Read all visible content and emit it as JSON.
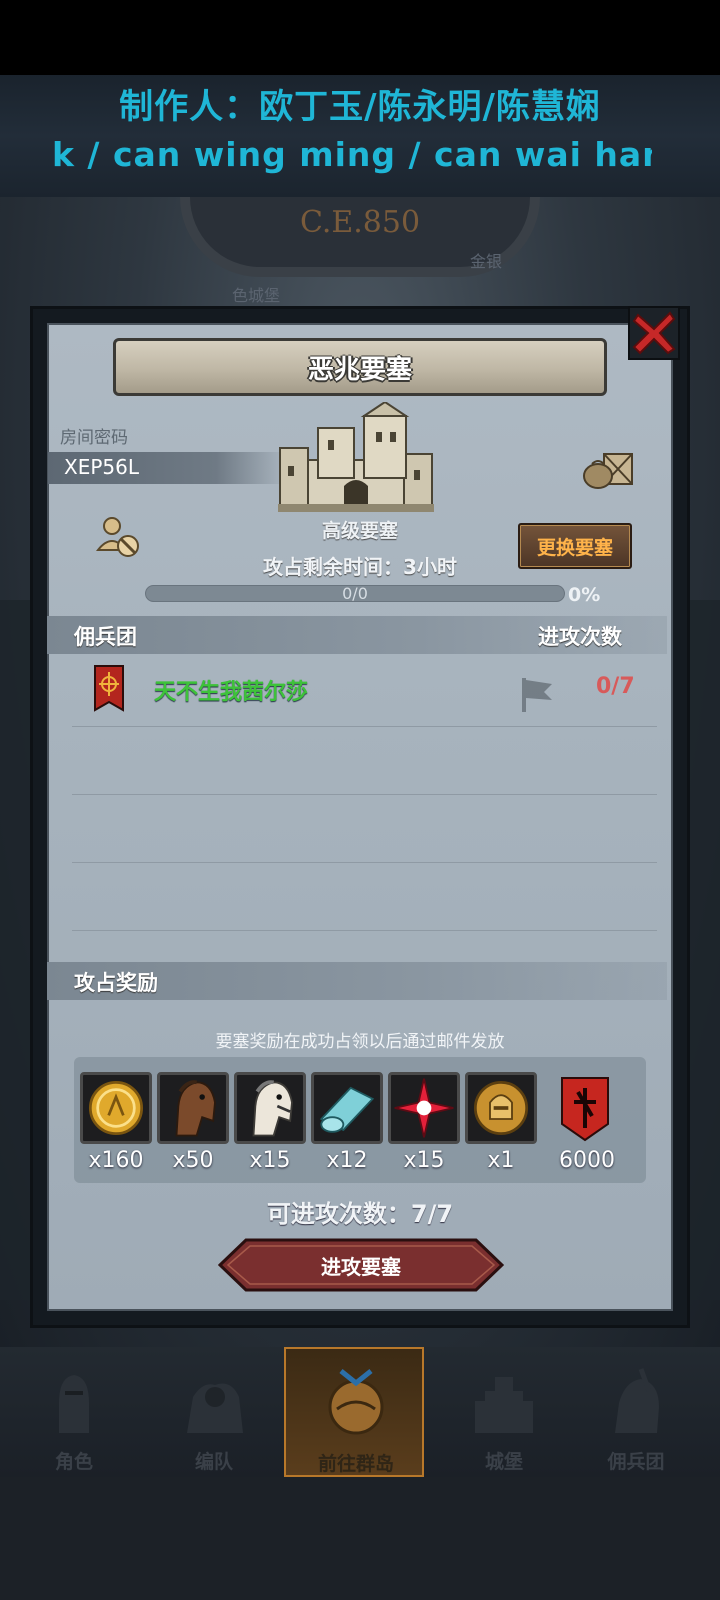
{
  "credits": {
    "line1": "制作人：欧丁玉/陈永明/陈慧娴",
    "line2": "k / can wing ming / can wai han"
  },
  "background": {
    "year": "C.E.850",
    "label_left": "色城堡",
    "label_right": "金银"
  },
  "modal": {
    "title": "恶兆要塞",
    "room_label": "房间密码",
    "room_code": "XEP56L",
    "fort_name": "高级要塞",
    "change_button": "更换要塞",
    "remaining_time": "攻占剩余时间：3小时",
    "progress": {
      "text": "0/0",
      "percent_label": "0%",
      "fraction": 0
    },
    "mercenary_header": "佣兵团",
    "attack_count_header": "进攻次数",
    "mercenaries": [
      {
        "name": "天不生我茜尔莎",
        "count": "0/7"
      }
    ],
    "rewards_header": "攻占奖励",
    "rewards_note": "要塞奖励在成功占领以后通过邮件发放",
    "rewards": [
      {
        "icon": "gold-coin-icon",
        "count": "x160"
      },
      {
        "icon": "brown-horse-icon",
        "count": "x50"
      },
      {
        "icon": "white-horse-icon",
        "count": "x15"
      },
      {
        "icon": "cloth-roll-icon",
        "count": "x12"
      },
      {
        "icon": "red-star-icon",
        "count": "x15"
      },
      {
        "icon": "knight-helmet-coin-icon",
        "count": "x1"
      },
      {
        "icon": "red-banner-icon",
        "count": "6000"
      }
    ],
    "attacks_left": "可进攻次数：7/7",
    "attack_button": "进攻要塞"
  },
  "nav": [
    {
      "label": "角色",
      "icon": "knight-icon"
    },
    {
      "label": "编队",
      "icon": "squad-icon"
    },
    {
      "label": "前往群岛",
      "icon": "island-compass-icon"
    },
    {
      "label": "城堡",
      "icon": "castle-icon"
    },
    {
      "label": "佣兵团",
      "icon": "mercenary-icon"
    }
  ],
  "colors": {
    "credit_text": "#1fb6d6",
    "merc_name": "#3ec23a",
    "merc_count": "#d85a5a",
    "change_button_text": "#ffb34a",
    "attack_button": "#7a2f2f"
  }
}
